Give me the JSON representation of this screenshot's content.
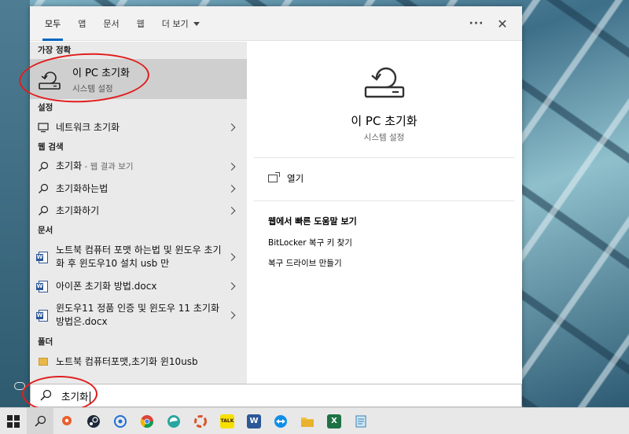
{
  "tabs": [
    {
      "label": "모두",
      "active": true
    },
    {
      "label": "앱"
    },
    {
      "label": "문서"
    },
    {
      "label": "웹"
    },
    {
      "label": "더 보기"
    }
  ],
  "topbar": {
    "more_label": "···",
    "close_label": "✕"
  },
  "sections": {
    "best_match": "가장 정확",
    "settings": "설정",
    "web": "웹 검색",
    "documents": "문서",
    "folders": "폴더"
  },
  "best_match": {
    "title": "이 PC 초기화",
    "subtitle": "시스템 설정"
  },
  "settings_items": [
    {
      "label": "네트워크 초기화"
    }
  ],
  "web_items": [
    {
      "label": "초기화",
      "sub": " - 웹 결과 보기"
    },
    {
      "label": "초기화하는법"
    },
    {
      "label": "초기화하기"
    }
  ],
  "document_items": [
    {
      "label": "노트북 컴퓨터 포맷 하는법 및 윈도우 초기화 후 윈도우10 설치 usb 만"
    },
    {
      "label": "아이폰 초기화 방법.docx"
    },
    {
      "label": "윈도우11 정품 인증 및 윈도우 11 초기화 방법은.docx"
    }
  ],
  "folder_items": [
    {
      "label": "노트북 컴퓨터포맷,초기화 윈10usb"
    }
  ],
  "detail": {
    "title": "이 PC 초기화",
    "subtitle": "시스템 설정",
    "open_label": "열기",
    "help_heading": "웹에서 빠른 도움말 보기",
    "help_links": [
      "BitLocker 복구 키 찾기",
      "복구 드라이브 만들기"
    ]
  },
  "search": {
    "query": "초기화"
  },
  "taskbar": {
    "icons": [
      "windows-start-icon",
      "search-icon",
      "maps-icon",
      "steam-icon",
      "app-icon",
      "chrome-icon",
      "edge-icon",
      "photos-icon",
      "kakaotalk-icon",
      "word-icon",
      "teamviewer-icon",
      "file-explorer-icon",
      "excel-icon",
      "notepad-icon"
    ],
    "kakao_label": "TALK",
    "word_label": "W",
    "excel_label": "X"
  },
  "colors": {
    "accent": "#0067c0",
    "annotation": "#e11d1d",
    "selected": "#cfcfcf"
  }
}
